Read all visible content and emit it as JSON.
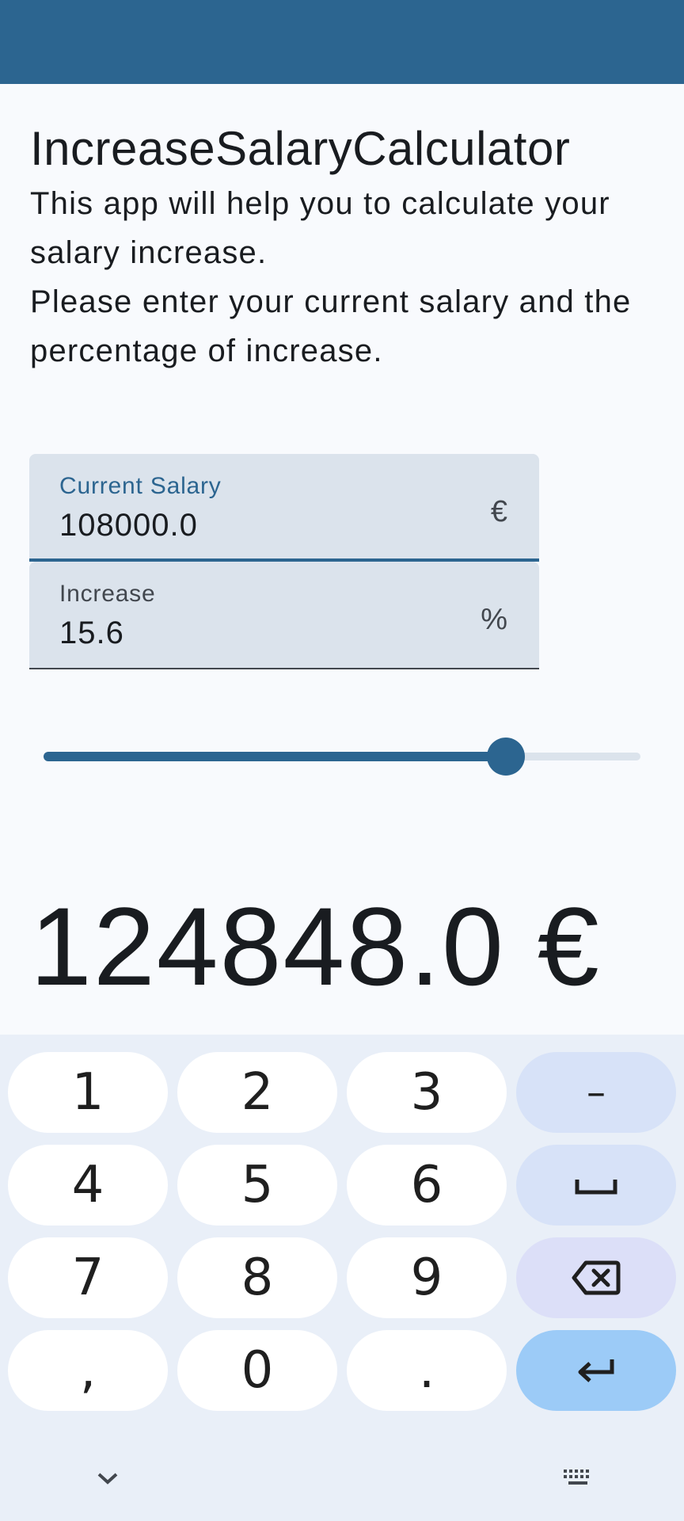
{
  "app": {
    "title": "IncreaseSalaryCalculator",
    "description_line1": "This app will help you to calculate your salary increase.",
    "description_line2": "Please enter your current salary and the percentage of increase."
  },
  "fields": {
    "salary": {
      "label": "Current Salary",
      "value": "108000.0",
      "suffix": "€"
    },
    "increase": {
      "label": "Increase",
      "value": "15.6",
      "suffix": "%"
    }
  },
  "slider": {
    "value_fraction": 0.775
  },
  "result": {
    "text": "124848.0 €"
  },
  "keyboard": {
    "keys": [
      {
        "label": "1"
      },
      {
        "label": "2"
      },
      {
        "label": "3"
      },
      {
        "label": "–"
      },
      {
        "label": "4"
      },
      {
        "label": "5"
      },
      {
        "label": "6"
      },
      {
        "label": "space-icon"
      },
      {
        "label": "7"
      },
      {
        "label": "8"
      },
      {
        "label": "9"
      },
      {
        "label": "backspace-icon"
      },
      {
        "label": ","
      },
      {
        "label": "0"
      },
      {
        "label": "."
      },
      {
        "label": "enter-icon"
      }
    ]
  },
  "colors": {
    "primary": "#2c6590",
    "field_bg": "#dbe3ec",
    "keyboard_bg": "#e9eff8",
    "enter_key": "#9ccbf7"
  }
}
